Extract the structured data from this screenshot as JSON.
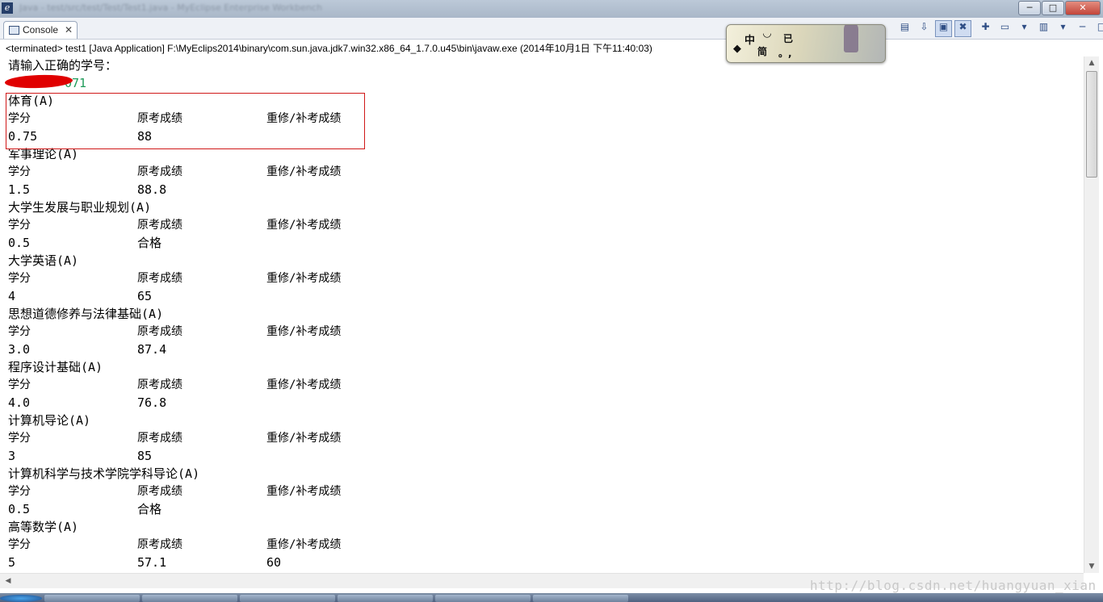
{
  "window": {
    "title_blurred": "Java - test/src/test/Test/Test1.java - MyEclipse Enterprise Workbench",
    "buttons": {
      "minimize": "─",
      "maximize": "□",
      "close": "✕"
    }
  },
  "console_tab": {
    "label": "Console",
    "close": "✕"
  },
  "view_toolbar": {
    "left_tools": [
      "clear-console",
      "pin",
      "scroll-lock",
      "show-stdout",
      "remove-launch"
    ],
    "right_tools": [
      "open-console",
      "display-selected",
      "menu",
      "minimize",
      "maximize"
    ]
  },
  "ime": {
    "zhong": "中",
    "moon": "◡",
    "ji": "已",
    "diamond": "◆",
    "jian": "简",
    "punct": "。,"
  },
  "status": "<terminated> test1 [Java Application] F:\\MyEclips2014\\binary\\com.sun.java.jdk7.win32.x86_64_1.7.0.u45\\bin\\javaw.exe (2014年10月1日 下午11:40:03)",
  "output": {
    "prompt": "请输入正确的学号：",
    "student_id_visible": "071",
    "headers": {
      "credit": "学分",
      "original": "原考成绩",
      "retake": "重修/补考成绩"
    },
    "courses": [
      {
        "name": "体育(A)",
        "credit": "0.75",
        "original": "88",
        "retake": ""
      },
      {
        "name": "军事理论(A)",
        "credit": "1.5",
        "original": "88.8",
        "retake": ""
      },
      {
        "name": "大学生发展与职业规划(A)",
        "credit": "0.5",
        "original": "合格",
        "retake": ""
      },
      {
        "name": "大学英语(A)",
        "credit": "4",
        "original": "65",
        "retake": ""
      },
      {
        "name": "思想道德修养与法律基础(A)",
        "credit": "3.0",
        "original": "87.4",
        "retake": ""
      },
      {
        "name": "程序设计基础(A)",
        "credit": "4.0",
        "original": "76.8",
        "retake": ""
      },
      {
        "name": "计算机导论(A)",
        "credit": "3",
        "original": "85",
        "retake": ""
      },
      {
        "name": "计算机科学与技术学院学科导论(A)",
        "credit": "0.5",
        "original": "合格",
        "retake": ""
      },
      {
        "name": "高等数学(A)",
        "credit": "5",
        "original": "57.1",
        "retake": "60"
      }
    ]
  },
  "watermark": "http://blog.csdn.net/huangyuan_xian"
}
